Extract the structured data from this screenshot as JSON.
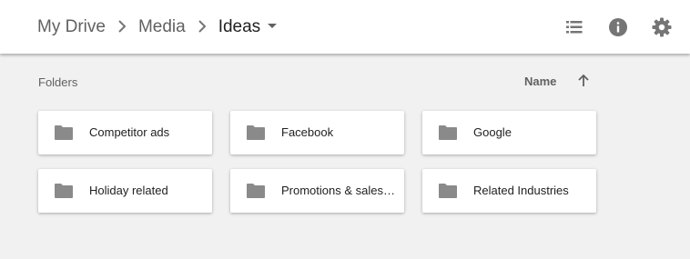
{
  "breadcrumb": {
    "items": [
      {
        "label": "My Drive"
      },
      {
        "label": "Media"
      },
      {
        "label": "Ideas"
      }
    ]
  },
  "toolbar": {
    "icons": [
      "list-view-icon",
      "info-icon",
      "settings-icon"
    ]
  },
  "folders_section": {
    "title": "Folders",
    "sort_label": "Name",
    "sort_direction": "ascending",
    "items": [
      {
        "name": "Competitor ads"
      },
      {
        "name": "Facebook"
      },
      {
        "name": "Google"
      },
      {
        "name": "Holiday related"
      },
      {
        "name": "Promotions & sales events"
      },
      {
        "name": "Related Industries"
      }
    ]
  },
  "colors": {
    "header_bg": "#ffffff",
    "page_bg": "#f1f1f1",
    "icon_gray": "#757575",
    "folder_icon": "#8a8a8a",
    "text_primary": "#212121",
    "text_secondary": "#616161"
  }
}
